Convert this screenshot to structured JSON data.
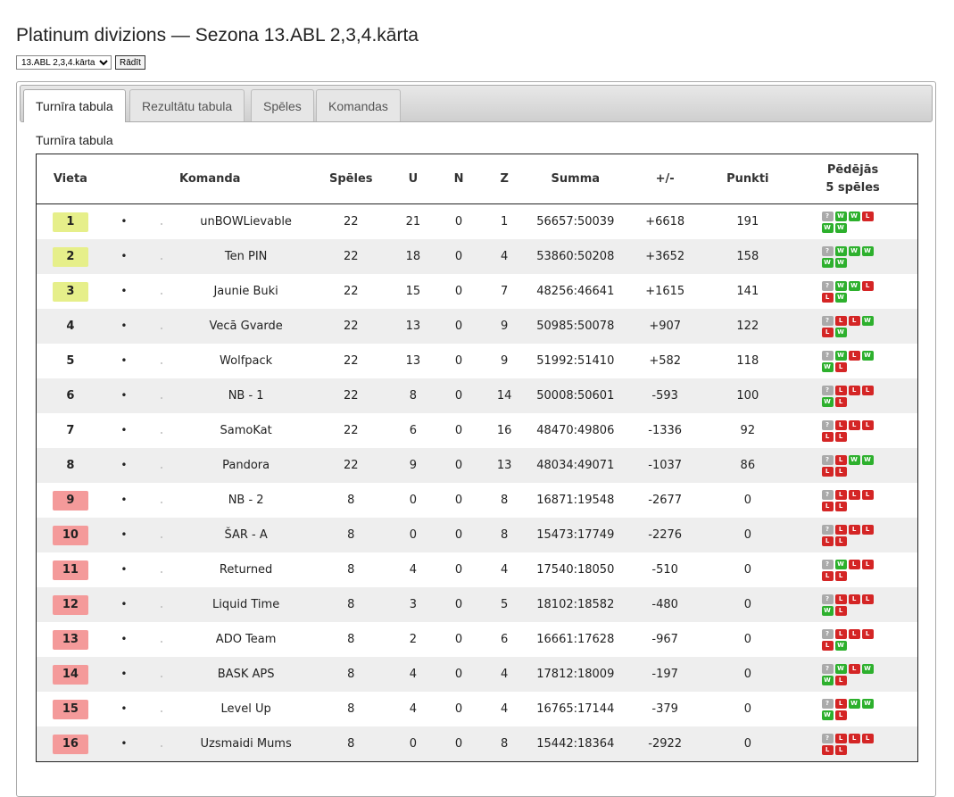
{
  "page": {
    "title": "Platinum divizions — Sezona 13.ABL 2,3,4.kārta"
  },
  "controls": {
    "season_selected": "13.ABL 2,3,4.kārta",
    "show_button": "Rādīt"
  },
  "tabs": [
    "Turnīra tabula",
    "Rezultātu tabula",
    "Spēles",
    "Komandas"
  ],
  "section": {
    "title": "Turnīra tabula"
  },
  "colors": {
    "promotion": "#e6ef8a",
    "relegation": "#f49a9a",
    "win": "#2db02d",
    "loss": "#d42525",
    "unknown": "#aaaaaa"
  },
  "table": {
    "headers": {
      "place": "Vieta",
      "team": "Komanda",
      "games": "Spēles",
      "wins": "U",
      "draws": "N",
      "losses": "Z",
      "sum": "Summa",
      "diff": "+/-",
      "points": "Punkti",
      "last5_line1": "Pēdējās",
      "last5_line2": "5 spēles"
    },
    "rows": [
      {
        "place": "1",
        "zone": "promo",
        "dot": "•",
        "team": "unBOWLievable",
        "games": "22",
        "wins": "21",
        "draws": "0",
        "losses": "1",
        "sum": "56657:50039",
        "diff": "+6618",
        "points": "191",
        "last": [
          "?",
          "W",
          "W",
          "L",
          "W",
          "W"
        ]
      },
      {
        "place": "2",
        "zone": "promo",
        "dot": "•",
        "team": "Ten PIN",
        "games": "22",
        "wins": "18",
        "draws": "0",
        "losses": "4",
        "sum": "53860:50208",
        "diff": "+3652",
        "points": "158",
        "last": [
          "?",
          "W",
          "W",
          "W",
          "W",
          "W"
        ]
      },
      {
        "place": "3",
        "zone": "promo",
        "dot": "•",
        "team": "Jaunie Buki",
        "games": "22",
        "wins": "15",
        "draws": "0",
        "losses": "7",
        "sum": "48256:46641",
        "diff": "+1615",
        "points": "141",
        "last": [
          "?",
          "W",
          "W",
          "L",
          "L",
          "W"
        ]
      },
      {
        "place": "4",
        "zone": "plain",
        "dot": "•",
        "team": "Vecā Gvarde",
        "games": "22",
        "wins": "13",
        "draws": "0",
        "losses": "9",
        "sum": "50985:50078",
        "diff": "+907",
        "points": "122",
        "last": [
          "?",
          "L",
          "L",
          "W",
          "L",
          "W"
        ]
      },
      {
        "place": "5",
        "zone": "plain",
        "dot": "•",
        "team": "Wolfpack",
        "games": "22",
        "wins": "13",
        "draws": "0",
        "losses": "9",
        "sum": "51992:51410",
        "diff": "+582",
        "points": "118",
        "last": [
          "?",
          "W",
          "L",
          "W",
          "W",
          "L"
        ]
      },
      {
        "place": "6",
        "zone": "plain",
        "dot": "•",
        "team": "NB - 1",
        "games": "22",
        "wins": "8",
        "draws": "0",
        "losses": "14",
        "sum": "50008:50601",
        "diff": "-593",
        "points": "100",
        "last": [
          "?",
          "L",
          "L",
          "L",
          "W",
          "L"
        ]
      },
      {
        "place": "7",
        "zone": "plain",
        "dot": "•",
        "team": "SamoKat",
        "games": "22",
        "wins": "6",
        "draws": "0",
        "losses": "16",
        "sum": "48470:49806",
        "diff": "-1336",
        "points": "92",
        "last": [
          "?",
          "L",
          "L",
          "L",
          "L",
          "L"
        ]
      },
      {
        "place": "8",
        "zone": "plain",
        "dot": "•",
        "team": "Pandora",
        "games": "22",
        "wins": "9",
        "draws": "0",
        "losses": "13",
        "sum": "48034:49071",
        "diff": "-1037",
        "points": "86",
        "last": [
          "?",
          "L",
          "W",
          "W",
          "L",
          "L"
        ]
      },
      {
        "place": "9",
        "zone": "releg",
        "dot": "•",
        "team": "NB - 2",
        "games": "8",
        "wins": "0",
        "draws": "0",
        "losses": "8",
        "sum": "16871:19548",
        "diff": "-2677",
        "points": "0",
        "last": [
          "?",
          "L",
          "L",
          "L",
          "L",
          "L"
        ]
      },
      {
        "place": "10",
        "zone": "releg",
        "dot": "•",
        "team": "ŠAR - A",
        "games": "8",
        "wins": "0",
        "draws": "0",
        "losses": "8",
        "sum": "15473:17749",
        "diff": "-2276",
        "points": "0",
        "last": [
          "?",
          "L",
          "L",
          "L",
          "L",
          "L"
        ]
      },
      {
        "place": "11",
        "zone": "releg",
        "dot": "•",
        "team": "Returned",
        "games": "8",
        "wins": "4",
        "draws": "0",
        "losses": "4",
        "sum": "17540:18050",
        "diff": "-510",
        "points": "0",
        "last": [
          "?",
          "W",
          "L",
          "L",
          "L",
          "L"
        ]
      },
      {
        "place": "12",
        "zone": "releg",
        "dot": "•",
        "team": "Liquid Time",
        "games": "8",
        "wins": "3",
        "draws": "0",
        "losses": "5",
        "sum": "18102:18582",
        "diff": "-480",
        "points": "0",
        "last": [
          "?",
          "L",
          "L",
          "L",
          "W",
          "L"
        ]
      },
      {
        "place": "13",
        "zone": "releg",
        "dot": "•",
        "team": "ADO Team",
        "games": "8",
        "wins": "2",
        "draws": "0",
        "losses": "6",
        "sum": "16661:17628",
        "diff": "-967",
        "points": "0",
        "last": [
          "?",
          "L",
          "L",
          "L",
          "L",
          "W"
        ]
      },
      {
        "place": "14",
        "zone": "releg",
        "dot": "•",
        "team": "BASK APS",
        "games": "8",
        "wins": "4",
        "draws": "0",
        "losses": "4",
        "sum": "17812:18009",
        "diff": "-197",
        "points": "0",
        "last": [
          "?",
          "W",
          "L",
          "W",
          "W",
          "L"
        ]
      },
      {
        "place": "15",
        "zone": "releg",
        "dot": "•",
        "team": "Level Up",
        "games": "8",
        "wins": "4",
        "draws": "0",
        "losses": "4",
        "sum": "16765:17144",
        "diff": "-379",
        "points": "0",
        "last": [
          "?",
          "L",
          "W",
          "W",
          "W",
          "L"
        ]
      },
      {
        "place": "16",
        "zone": "releg",
        "dot": "•",
        "team": "Uzsmaidi Mums",
        "games": "8",
        "wins": "0",
        "draws": "0",
        "losses": "8",
        "sum": "15442:18364",
        "diff": "-2922",
        "points": "0",
        "last": [
          "?",
          "L",
          "L",
          "L",
          "L",
          "L"
        ]
      }
    ]
  }
}
